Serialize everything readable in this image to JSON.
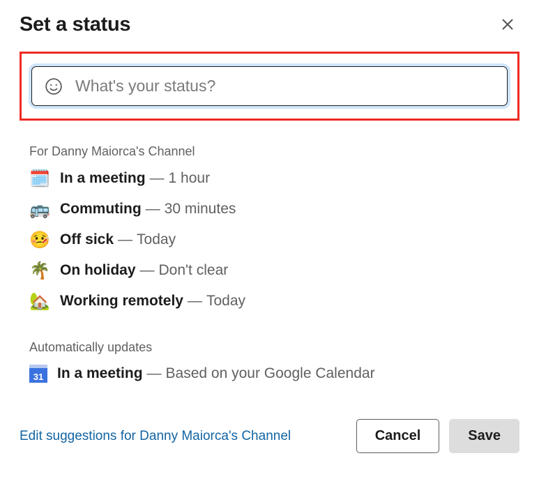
{
  "title": "Set a status",
  "input": {
    "placeholder": "What's your status?"
  },
  "suggestions": {
    "header": "For Danny Maiorca's Channel",
    "items": [
      {
        "emoji": "🗓️",
        "label": "In a meeting",
        "duration": "1 hour"
      },
      {
        "emoji": "🚌",
        "label": "Commuting",
        "duration": "30 minutes"
      },
      {
        "emoji": "🤒",
        "label": "Off sick",
        "duration": "Today"
      },
      {
        "emoji": "🌴",
        "label": "On holiday",
        "duration": "Don't clear"
      },
      {
        "emoji": "🏡",
        "label": "Working remotely",
        "duration": "Today"
      }
    ]
  },
  "auto": {
    "header": "Automatically updates",
    "items": [
      {
        "icon_text": "31",
        "label": "In a meeting",
        "duration": "Based on your Google Calendar"
      }
    ]
  },
  "footer": {
    "edit_link": "Edit suggestions for Danny Maiorca's Channel",
    "cancel": "Cancel",
    "save": "Save"
  },
  "sep": " — "
}
